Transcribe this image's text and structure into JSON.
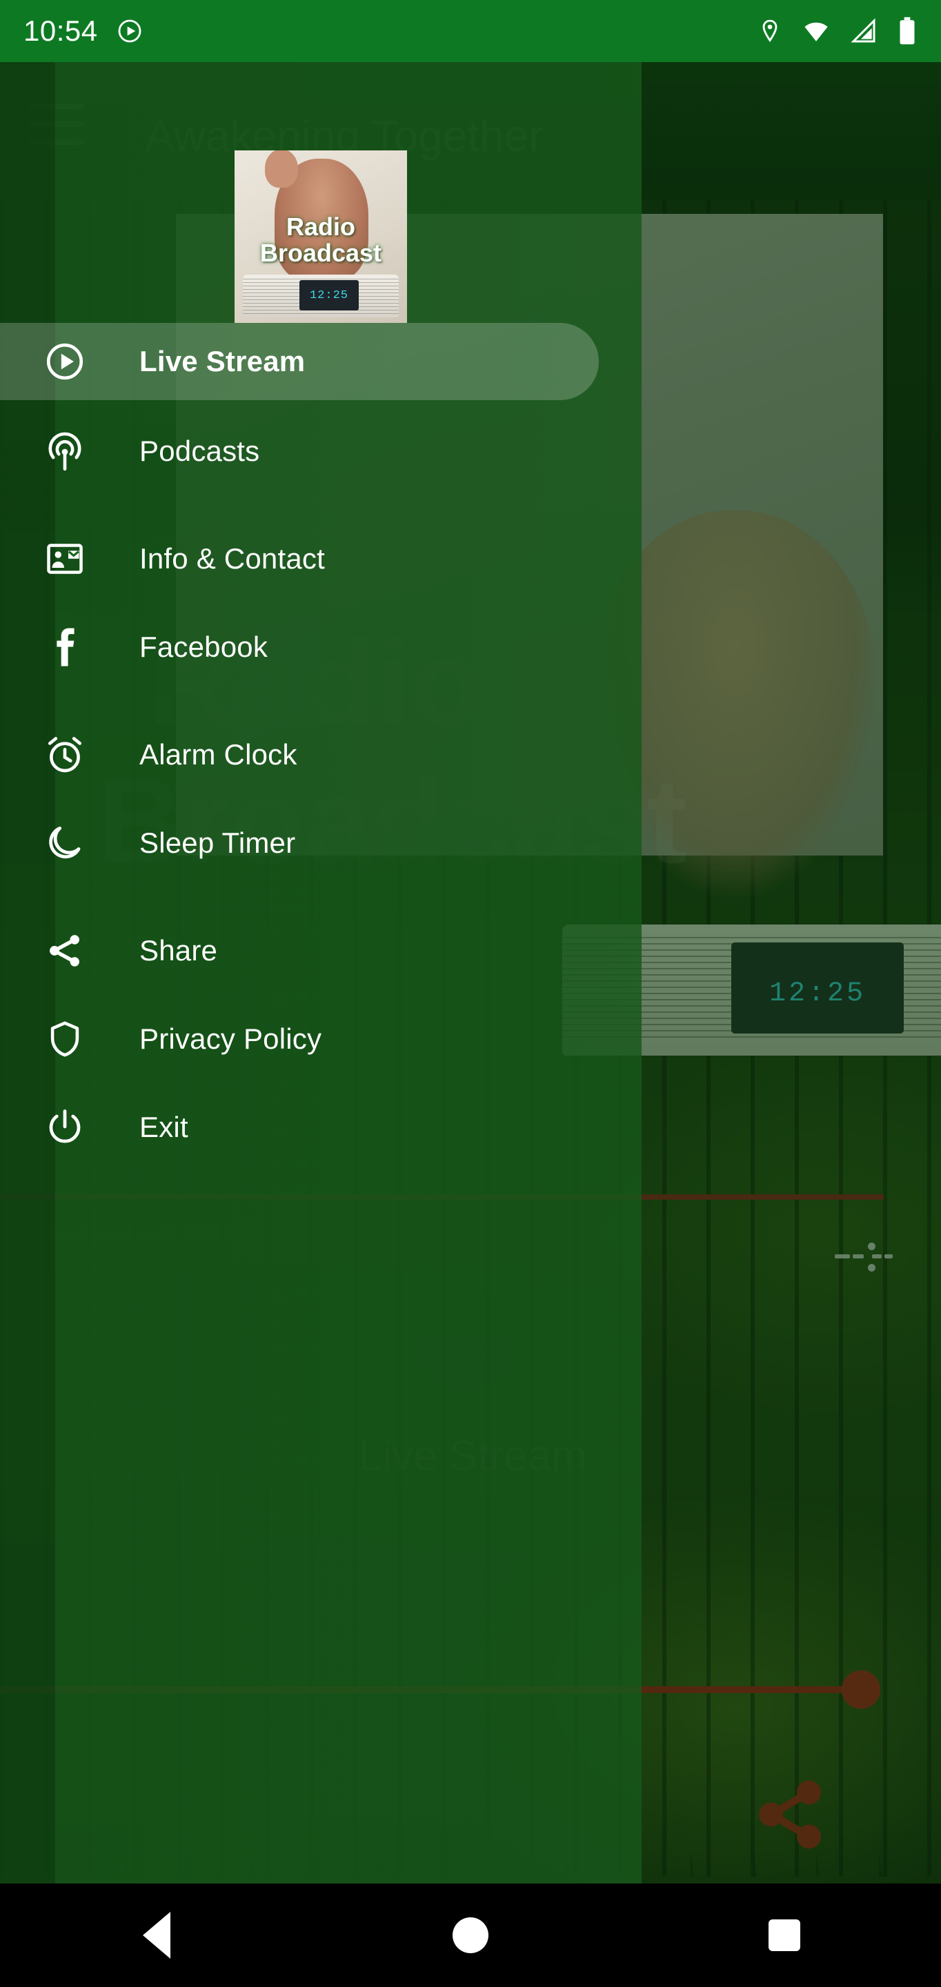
{
  "status_bar": {
    "time": "10:54",
    "icons": [
      "cast-play-icon",
      "location-icon",
      "wifi-icon",
      "cellular-signal-icon",
      "battery-icon"
    ]
  },
  "app": {
    "title": "Awakening Together",
    "menu_icon": "hamburger-menu-icon"
  },
  "drawer": {
    "header": {
      "logo_alt": "radio-broadcast-logo",
      "caption_line1": "Radio",
      "caption_line2": "Broadcast",
      "radio_display": "12:25"
    },
    "items": [
      {
        "label": "Live Stream",
        "icon": "play-circle-icon",
        "selected": true
      },
      {
        "label": "Podcasts",
        "icon": "podcast-icon",
        "selected": false
      },
      {
        "label": "Info & Contact",
        "icon": "contact-card-icon",
        "selected": false
      },
      {
        "label": "Facebook",
        "icon": "facebook-icon",
        "selected": false
      },
      {
        "label": "Alarm Clock",
        "icon": "alarm-clock-icon",
        "selected": false
      },
      {
        "label": "Sleep Timer",
        "icon": "moon-icon",
        "selected": false
      },
      {
        "label": "Share",
        "icon": "share-icon",
        "selected": false
      },
      {
        "label": "Privacy Policy",
        "icon": "shield-icon",
        "selected": false
      },
      {
        "label": "Exit",
        "icon": "power-icon",
        "selected": false
      }
    ]
  },
  "background_player": {
    "title": "Awakening Together",
    "overlay_text_line1": "Radio",
    "overlay_text_line2": "Broadcast",
    "now_playing_label": "Live Stream",
    "artwork_display": "12:25"
  },
  "nav_bar": {
    "back": "back-button",
    "home": "home-button",
    "recents": "recents-button"
  },
  "colors": {
    "status_bar": "#0d7a23",
    "drawer": "#16581a",
    "accent_red": "#aa1111",
    "nav_bar": "#000000",
    "text": "#ffffff"
  }
}
